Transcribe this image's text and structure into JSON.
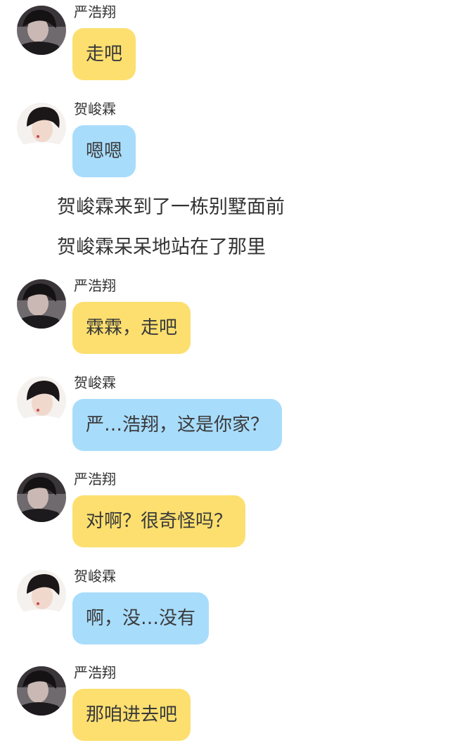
{
  "characters": {
    "yan": {
      "name": "严浩翔",
      "bubble_color": "#fcdf6f"
    },
    "he": {
      "name": "贺峻霖",
      "bubble_color": "#a8dcfb"
    }
  },
  "messages": [
    {
      "sender": "严浩翔",
      "text": "走吧"
    },
    {
      "sender": "贺峻霖",
      "text": "嗯嗯"
    },
    {
      "narration": "贺峻霖来到了一栋别墅面前"
    },
    {
      "narration": "贺峻霖呆呆地站在了那里"
    },
    {
      "sender": "严浩翔",
      "text": "霖霖，走吧"
    },
    {
      "sender": "贺峻霖",
      "text": "严…浩翔，这是你家？"
    },
    {
      "sender": "严浩翔",
      "text": "对啊？很奇怪吗？"
    },
    {
      "sender": "贺峻霖",
      "text": "啊，没…没有"
    },
    {
      "sender": "严浩翔",
      "text": "那咱进去吧"
    }
  ]
}
